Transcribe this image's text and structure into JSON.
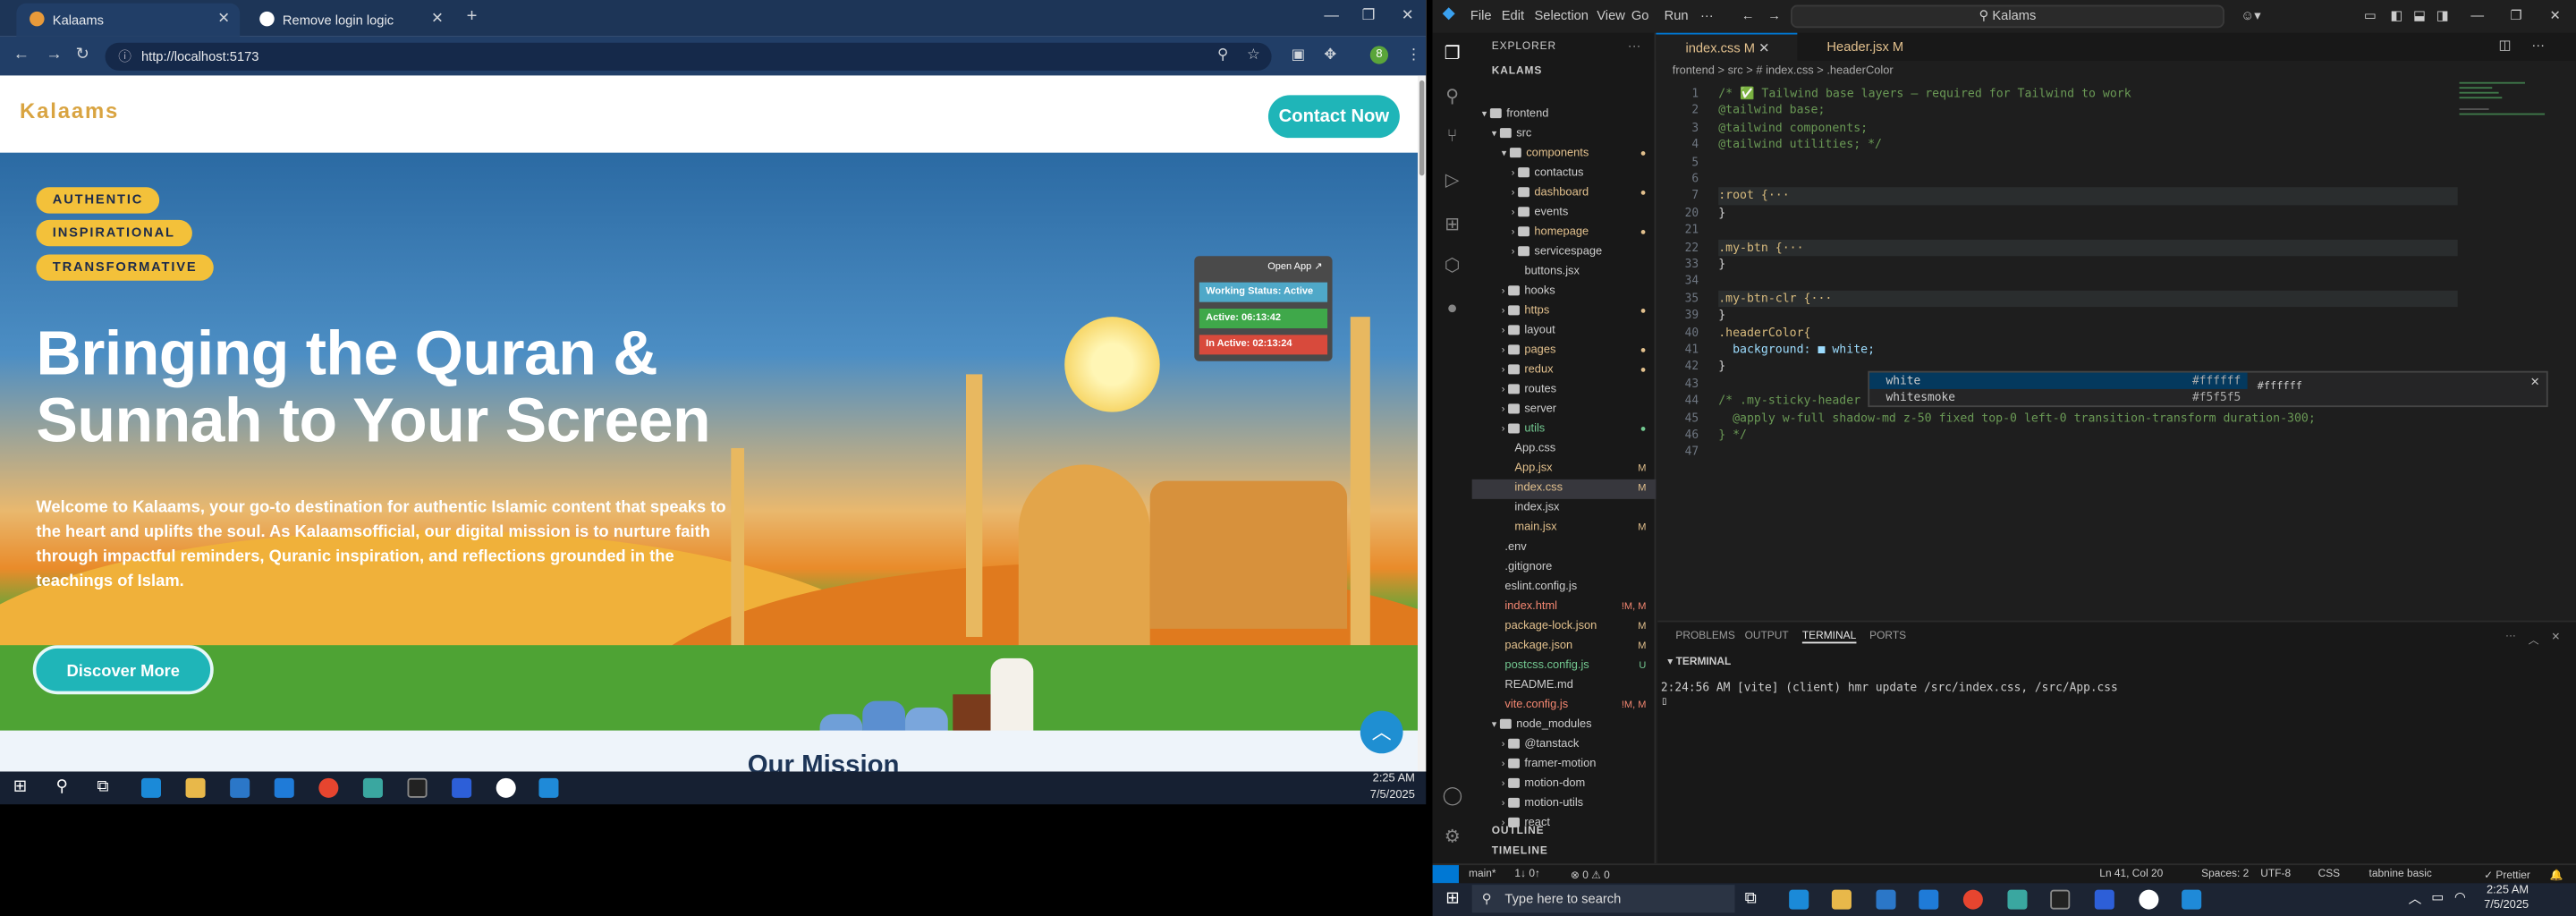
{
  "browser": {
    "tabs": [
      {
        "label": "Kalaams",
        "active": true
      },
      {
        "label": "Remove login logic",
        "active": false
      }
    ],
    "url": "http://localhost:5173"
  },
  "site": {
    "logo": "Kalaams",
    "contact_label": "Contact Now",
    "badges": [
      "AUTHENTIC",
      "INSPIRATIONAL",
      "TRANSFORMATIVE"
    ],
    "headline": [
      "Bringing the Quran &",
      "Sunnah to Your Screen"
    ],
    "intro_parts": [
      "Welcome to ",
      "Kalaams",
      ", your go-to destination for ",
      "authentic Islamic content",
      " that speaks to the heart and uplifts the soul. As ",
      "Kalaamsofficial",
      ", our digital mission is to nurture faith through impactful reminders, Quranic inspiration, and reflections grounded in the teachings of Islam."
    ],
    "discover_label": "Discover More",
    "next_section": "Our Mission"
  },
  "widget": {
    "title": "Open App ↗",
    "working": "Working Status: Active",
    "active": "Active: 06:13:42",
    "inactive": "In Active: 02:13:24"
  },
  "taskbar_left": {
    "time": "2:25 AM",
    "date": "7/5/2025"
  },
  "vscode": {
    "menu": [
      "File",
      "Edit",
      "Selection",
      "View",
      "Go",
      "Run",
      "···"
    ],
    "search": "Kalams",
    "explorer_title": "EXPLORER",
    "root": "KALAMS",
    "tree": [
      {
        "label": "frontend",
        "type": "folder",
        "open": true,
        "indent": 0,
        "status": ""
      },
      {
        "label": "src",
        "type": "folder",
        "open": true,
        "indent": 1,
        "status": ""
      },
      {
        "label": "components",
        "type": "folder",
        "open": true,
        "indent": 2,
        "status": "dot-mod"
      },
      {
        "label": "contactus",
        "type": "folder",
        "open": false,
        "indent": 3,
        "status": ""
      },
      {
        "label": "dashboard",
        "type": "folder",
        "open": false,
        "indent": 3,
        "status": "dot-mod"
      },
      {
        "label": "events",
        "type": "folder",
        "open": false,
        "indent": 3,
        "status": ""
      },
      {
        "label": "homepage",
        "type": "folder",
        "open": false,
        "indent": 3,
        "status": "dot-mod"
      },
      {
        "label": "servicespage",
        "type": "folder",
        "open": false,
        "indent": 3,
        "status": ""
      },
      {
        "label": "buttons.jsx",
        "type": "file",
        "indent": 3,
        "status": ""
      },
      {
        "label": "hooks",
        "type": "folder",
        "open": false,
        "indent": 2,
        "status": ""
      },
      {
        "label": "https",
        "type": "folder",
        "open": false,
        "indent": 2,
        "status": "dot-mod"
      },
      {
        "label": "layout",
        "type": "folder",
        "open": false,
        "indent": 2,
        "status": ""
      },
      {
        "label": "pages",
        "type": "folder",
        "open": false,
        "indent": 2,
        "status": "dot-mod"
      },
      {
        "label": "redux",
        "type": "folder",
        "open": false,
        "indent": 2,
        "status": "dot-mod"
      },
      {
        "label": "routes",
        "type": "folder",
        "open": false,
        "indent": 2,
        "status": ""
      },
      {
        "label": "server",
        "type": "folder",
        "open": false,
        "indent": 2,
        "status": ""
      },
      {
        "label": "utils",
        "type": "folder",
        "open": false,
        "indent": 2,
        "status": "dot-unt"
      },
      {
        "label": "App.css",
        "type": "file",
        "indent": 2,
        "status": ""
      },
      {
        "label": "App.jsx",
        "type": "file",
        "indent": 2,
        "status": "M"
      },
      {
        "label": "index.css",
        "type": "file",
        "indent": 2,
        "status": "M",
        "selected": true
      },
      {
        "label": "index.jsx",
        "type": "file",
        "indent": 2,
        "status": ""
      },
      {
        "label": "main.jsx",
        "type": "file",
        "indent": 2,
        "status": "M"
      },
      {
        "label": ".env",
        "type": "file",
        "indent": 1,
        "status": ""
      },
      {
        "label": ".gitignore",
        "type": "file",
        "indent": 1,
        "status": ""
      },
      {
        "label": "eslint.config.js",
        "type": "file",
        "indent": 1,
        "status": ""
      },
      {
        "label": "index.html",
        "type": "file",
        "indent": 1,
        "status": "!M, M"
      },
      {
        "label": "package-lock.json",
        "type": "file",
        "indent": 1,
        "status": "M"
      },
      {
        "label": "package.json",
        "type": "file",
        "indent": 1,
        "status": "M"
      },
      {
        "label": "postcss.config.js",
        "type": "file",
        "indent": 1,
        "status": "U"
      },
      {
        "label": "README.md",
        "type": "file",
        "indent": 1,
        "status": ""
      },
      {
        "label": "vite.config.js",
        "type": "file",
        "indent": 1,
        "status": "!M, M"
      },
      {
        "label": "node_modules",
        "type": "folder",
        "open": true,
        "indent": 1,
        "status": ""
      },
      {
        "label": "@tanstack",
        "type": "folder",
        "open": false,
        "indent": 2,
        "status": ""
      },
      {
        "label": "framer-motion",
        "type": "folder",
        "open": false,
        "indent": 2,
        "status": ""
      },
      {
        "label": "motion-dom",
        "type": "folder",
        "open": false,
        "indent": 2,
        "status": ""
      },
      {
        "label": "motion-utils",
        "type": "folder",
        "open": false,
        "indent": 2,
        "status": ""
      },
      {
        "label": "react",
        "type": "folder",
        "open": false,
        "indent": 2,
        "status": ""
      }
    ],
    "outline": "OUTLINE",
    "timeline": "TIMELINE",
    "editor_tabs": [
      {
        "label": "index.css M",
        "active": true
      },
      {
        "label": "Header.jsx M",
        "active": false
      }
    ],
    "breadcrumb": "frontend > src > # index.css > .headerColor",
    "lines": [
      {
        "n": "1",
        "text": "/* ✅ Tailwind base layers — required for Tailwind to work",
        "kind": "cm"
      },
      {
        "n": "2",
        "text": "@tailwind base;",
        "kind": "cm"
      },
      {
        "n": "3",
        "text": "@tailwind components;",
        "kind": "cm"
      },
      {
        "n": "4",
        "text": "@tailwind utilities; */",
        "kind": "cm"
      },
      {
        "n": "5",
        "text": "",
        "kind": ""
      },
      {
        "n": "6",
        "text": "",
        "kind": ""
      },
      {
        "n": "7",
        "text": ":root {···",
        "kind": "fold"
      },
      {
        "n": "20",
        "text": "}",
        "kind": ""
      },
      {
        "n": "21",
        "text": "",
        "kind": ""
      },
      {
        "n": "22",
        "text": ".my-btn {···",
        "kind": "fold"
      },
      {
        "n": "33",
        "text": "}",
        "kind": ""
      },
      {
        "n": "34",
        "text": "",
        "kind": ""
      },
      {
        "n": "35",
        "text": ".my-btn-clr {···",
        "kind": "fold"
      },
      {
        "n": "39",
        "text": "}",
        "kind": ""
      },
      {
        "n": "40",
        "text": ".headerColor{",
        "kind": "sel"
      },
      {
        "n": "41",
        "text": "  background: ■ white;",
        "kind": "prop"
      },
      {
        "n": "42",
        "text": "}",
        "kind": ""
      },
      {
        "n": "43",
        "text": "",
        "kind": ""
      },
      {
        "n": "44",
        "text": "/* .my-sticky-header {",
        "kind": "cm"
      },
      {
        "n": "45",
        "text": "  @apply w-full shadow-md z-50 fixed top-0 left-0 transition-transform duration-300;",
        "kind": "cm"
      },
      {
        "n": "46",
        "text": "} */",
        "kind": "cm"
      },
      {
        "n": "47",
        "text": "",
        "kind": ""
      }
    ],
    "suggest": [
      {
        "label": "white",
        "value": "#ffffff"
      },
      {
        "label": "whitesmoke",
        "value": "#f5f5f5"
      }
    ],
    "suggest_detail": "#ffffff",
    "panel_tabs": [
      "PROBLEMS",
      "OUTPUT",
      "TERMINAL",
      "PORTS"
    ],
    "terminal_title": "TERMINAL",
    "terminal_line": "2:24:56 AM [vite] (client) hmr update /src/index.css, /src/App.css",
    "status": {
      "branch": "main*",
      "sync": "1↓ 0↑",
      "problems": "⊗ 0 ⚠ 0",
      "position": "Ln 41, Col 20",
      "spaces": "Spaces: 2",
      "encoding": "UTF-8",
      "lang": "CSS",
      "tabnine": "tabnine basic",
      "prettier": "✓ Prettier"
    }
  },
  "taskbar_right": {
    "search": "Type here to search",
    "time": "2:25 AM",
    "date": "7/5/2025"
  }
}
